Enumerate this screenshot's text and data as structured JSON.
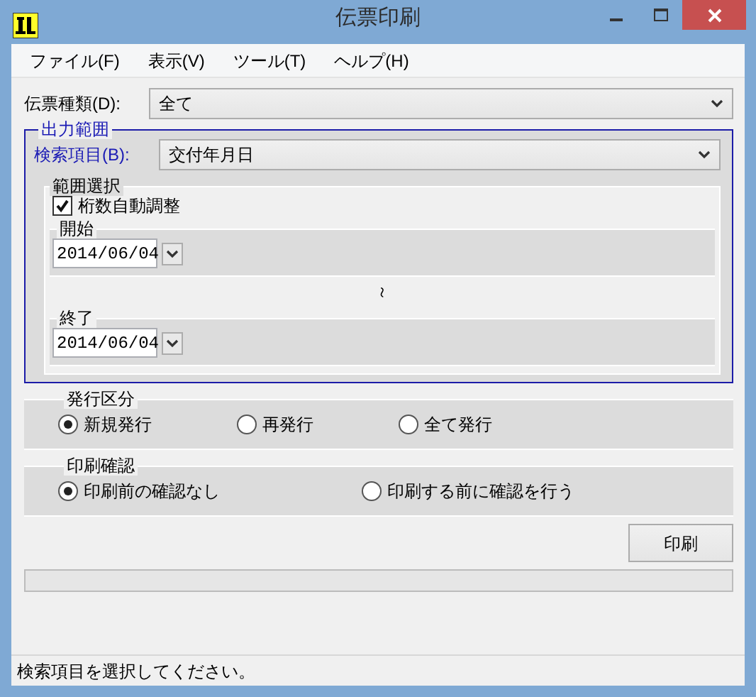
{
  "window": {
    "title": "伝票印刷"
  },
  "menu": [
    {
      "label": "ファイル(F)"
    },
    {
      "label": "表示(V)"
    },
    {
      "label": "ツール(T)"
    },
    {
      "label": "ヘルプ(H)"
    }
  ],
  "slip_type": {
    "label": "伝票種類(D):",
    "value": "全て"
  },
  "output_range": {
    "title": "出力範囲",
    "search_item": {
      "label": "検索項目(B):",
      "value": "交付年月日"
    },
    "range_selection": {
      "title": "範囲選択",
      "auto_adjust": {
        "label": "桁数自動調整",
        "checked": true
      },
      "start": {
        "title": "開始",
        "value": "2014/06/04"
      },
      "separator": "～",
      "end": {
        "title": "終了",
        "value": "2014/06/04"
      }
    }
  },
  "issue_type": {
    "title": "発行区分",
    "options": [
      {
        "label": "新規発行",
        "selected": true
      },
      {
        "label": "再発行",
        "selected": false
      },
      {
        "label": "全て発行",
        "selected": false
      }
    ]
  },
  "print_confirm": {
    "title": "印刷確認",
    "options": [
      {
        "label": "印刷前の確認なし",
        "selected": true
      },
      {
        "label": "印刷する前に確認を行う",
        "selected": false
      }
    ]
  },
  "print_button": "印刷",
  "progress": {
    "level": 0
  },
  "status_bar": "検索項目を選択してください。"
}
